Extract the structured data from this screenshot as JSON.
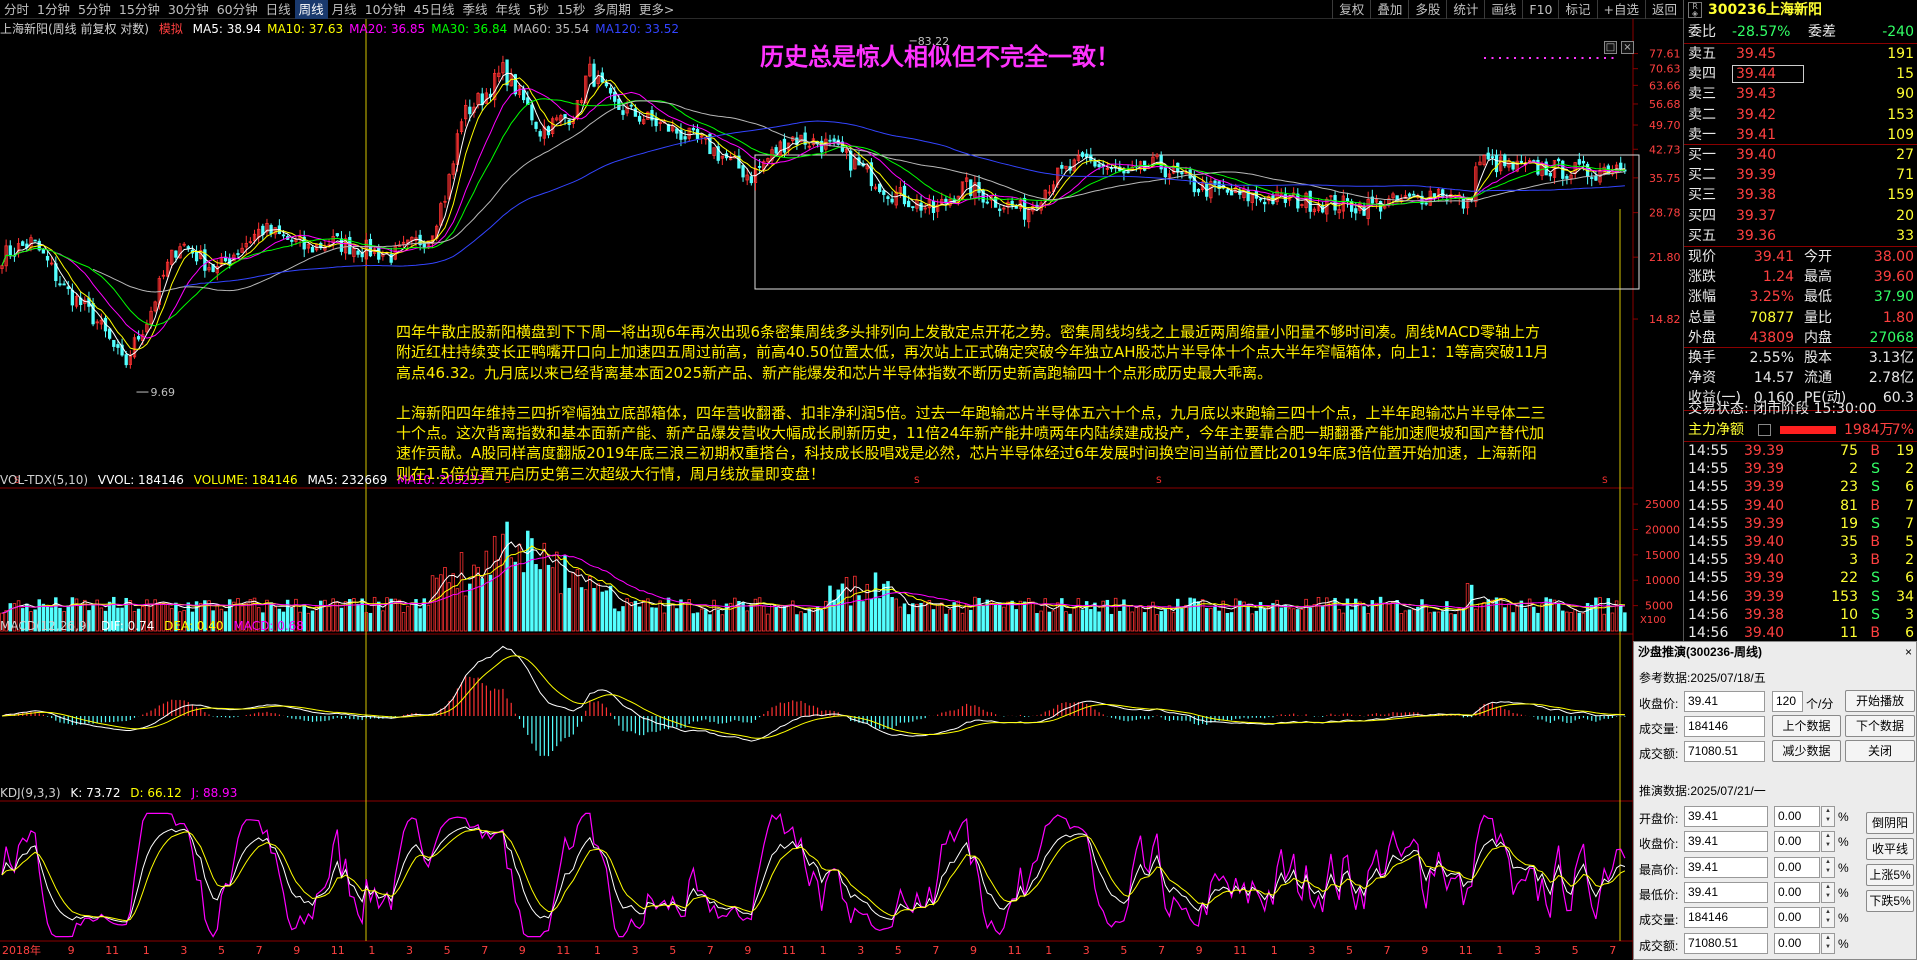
{
  "toolbar": {
    "periods": [
      "分时",
      "1分钟",
      "5分钟",
      "15分钟",
      "30分钟",
      "60分钟",
      "日线",
      "周线",
      "月线",
      "10分钟",
      "45日线",
      "季线",
      "年线",
      "5秒",
      "15秒",
      "多周期",
      "更多>"
    ],
    "active_period": "周线",
    "tools": [
      "复权",
      "叠加",
      "多股",
      "统计",
      "画线",
      "F10",
      "标记",
      "+自选",
      "返回"
    ]
  },
  "main_chart": {
    "stock_name": "上海新阳(周线 前复权 对数)",
    "mode": "模拟",
    "ma": [
      {
        "label": "MA5: 38.94",
        "color": "#ffffff"
      },
      {
        "label": "MA10: 37.63",
        "color": "#ffff00"
      },
      {
        "label": "MA20: 36.85",
        "color": "#ff00ff"
      },
      {
        "label": "MA30: 36.84",
        "color": "#00ff00"
      },
      {
        "label": "MA60: 35.54",
        "color": "#b8b8b8"
      },
      {
        "label": "MA120: 33.52",
        "color": "#3344ff"
      }
    ],
    "title": "历史总是惊人相似但不完全一致！",
    "price_axis": [
      "77.61",
      "70.63",
      "63.66",
      "56.68",
      "49.70",
      "42.73",
      "35.75",
      "28.78",
      "21.80",
      "14.82"
    ],
    "high_label": "83.22",
    "low_label": "9.69"
  },
  "annotation": {
    "p1": "四年牛散庄股新阳横盘到下下周一将出现6年再次出现6条密集周线多头排列向上发散定点开花之势。密集周线均线之上最近两周缩量小阳量不够时间凑。周线MACD零轴上方附近红柱持续变长正鸭嘴开口向上加速四五周过前高，前高40.50位置太低，再次站上正式确定突破今年独立AH股芯片半导体十个点大半年窄幅箱体，向上1：1等高突破11月高点46.32。九月底以来已经背离基本面2025新产品、新产能爆发和芯片半导体指数不断历史新高跑输四十个点形成历史最大乖离。",
    "p2": "上海新阳四年维持三四折窄幅独立底部箱体，四年营收翻番、扣非净利润5倍。过去一年跑输芯片半导体五六十个点，九月底以来跑输三四十个点，上半年跑输芯片半导体二三十个点。这次背离指数和基本面新产能、新产品爆发营收大幅成长刷新历史，11倍24年新产能井喷两年内陆续建成投产，今年主要靠合肥一期翻番产能加速爬坡和国产替代加速作贡献。A股同样高度翻版2019年底三浪三初期权重搭台，科技成长股唱戏是必然，芯片半导体经过6年发展时间换空间当前位置比2019年底3倍位置开始加速，上海新阳则在1.5倍位置开启历史第三次超级大行情，周月线放量即变盘！"
  },
  "vol_panel": {
    "name": "VOL-TDX(5,10)",
    "vvol": "VVOL: 184146",
    "volume": "VOLUME: 184146",
    "ma5": "MA5: 232669",
    "ma10": "MA10: 203233",
    "axis": [
      "25000",
      "20000",
      "15000",
      "10000",
      "5000"
    ],
    "unit": "X100"
  },
  "macd_panel": {
    "name": "MACD(12,26,9)",
    "dif": "DIF: 0.74",
    "dea": "DEA: 0.40",
    "macd": "MACD: 0.68"
  },
  "kdj_panel": {
    "name": "KDJ(9,3,3)",
    "k": "K: 73.72",
    "d": "D: 66.12",
    "j": "J: 88.93"
  },
  "x_axis": [
    "2018年",
    "9",
    "11",
    "1",
    "3",
    "5",
    "7",
    "9",
    "11",
    "1",
    "3",
    "5",
    "7",
    "9",
    "11",
    "1",
    "3",
    "5",
    "7",
    "9",
    "11",
    "1",
    "3",
    "5",
    "7",
    "9",
    "11",
    "1",
    "3",
    "5",
    "7",
    "9",
    "11",
    "1",
    "3",
    "5",
    "7",
    "9",
    "11",
    "1",
    "3",
    "5",
    "7"
  ],
  "quote": {
    "code": "300236",
    "name": "上海新阳",
    "webi_label": "委比",
    "webi": "-28.57%",
    "weicha_label": "委差",
    "weicha": "-240",
    "asks": [
      {
        "label": "卖五",
        "price": "39.45",
        "vol": "191"
      },
      {
        "label": "卖四",
        "price": "39.44",
        "vol": "15"
      },
      {
        "label": "卖三",
        "price": "39.43",
        "vol": "90"
      },
      {
        "label": "卖二",
        "price": "39.42",
        "vol": "153"
      },
      {
        "label": "卖一",
        "price": "39.41",
        "vol": "109"
      }
    ],
    "bids": [
      {
        "label": "买一",
        "price": "39.40",
        "vol": "27"
      },
      {
        "label": "买二",
        "price": "39.39",
        "vol": "71"
      },
      {
        "label": "买三",
        "price": "39.38",
        "vol": "159"
      },
      {
        "label": "买四",
        "price": "39.37",
        "vol": "20"
      },
      {
        "label": "买五",
        "price": "39.36",
        "vol": "33"
      }
    ],
    "stats": [
      {
        "l1": "现价",
        "v1": "39.41",
        "l2": "今开",
        "v2": "38.00"
      },
      {
        "l1": "涨跌",
        "v1": "1.24",
        "l2": "最高",
        "v2": "39.60"
      },
      {
        "l1": "涨幅",
        "v1": "3.25%",
        "l2": "最低",
        "v2": "37.90"
      },
      {
        "l1": "总量",
        "v1": "70877",
        "l2": "量比",
        "v2": "1.80"
      },
      {
        "l1": "外盘",
        "v1": "43809",
        "l2": "内盘",
        "v2": "27068"
      }
    ],
    "stats2": [
      {
        "l1": "换手",
        "v1": "2.55%",
        "l2": "股本",
        "v2": "3.13亿"
      },
      {
        "l1": "净资",
        "v1": "14.57",
        "l2": "流通",
        "v2": "2.78亿"
      },
      {
        "l1": "收益(一)",
        "v1": "0.160",
        "l2": "PE(动)",
        "v2": "60.3"
      }
    ],
    "status": "交易状态: 闭市阶段 15:30:00",
    "flow_label": "主力净额",
    "flow_value": "1984万",
    "flow_pct": "7%",
    "ticks": [
      {
        "t": "14:55",
        "p": "39.39",
        "v": "75",
        "d": "B",
        "n": "19"
      },
      {
        "t": "14:55",
        "p": "39.39",
        "v": "2",
        "d": "S",
        "n": "2"
      },
      {
        "t": "14:55",
        "p": "39.39",
        "v": "23",
        "d": "S",
        "n": "6"
      },
      {
        "t": "14:55",
        "p": "39.40",
        "v": "81",
        "d": "B",
        "n": "7"
      },
      {
        "t": "14:55",
        "p": "39.39",
        "v": "19",
        "d": "S",
        "n": "7"
      },
      {
        "t": "14:55",
        "p": "39.40",
        "v": "35",
        "d": "B",
        "n": "5"
      },
      {
        "t": "14:55",
        "p": "39.40",
        "v": "3",
        "d": "B",
        "n": "2"
      },
      {
        "t": "14:55",
        "p": "39.39",
        "v": "22",
        "d": "S",
        "n": "6"
      },
      {
        "t": "14:56",
        "p": "39.39",
        "v": "153",
        "d": "S",
        "n": "34"
      },
      {
        "t": "14:56",
        "p": "39.38",
        "v": "10",
        "d": "S",
        "n": "3"
      },
      {
        "t": "14:56",
        "p": "39.40",
        "v": "11",
        "d": "B",
        "n": "6"
      }
    ]
  },
  "dialog": {
    "title": "沙盘推演(300236-周线)",
    "close": "×",
    "ref_label": "参考数据:2025/07/18/五",
    "close_label": "收盘价:",
    "close_val": "39.41",
    "vol_label": "成交量:",
    "vol_val": "184146",
    "amt_label": "成交额:",
    "amt_val": "71080.51",
    "speed_val": "120",
    "speed_unit": "个/分",
    "btn_play": "开始播放",
    "btn_prev": "上个数据",
    "btn_next": "下个数据",
    "btn_less": "减少数据",
    "btn_close": "关闭",
    "sim_label": "推演数据:2025/07/21/一",
    "rows": [
      {
        "label": "开盘价:",
        "val": "39.41",
        "pct": "0.00"
      },
      {
        "label": "收盘价:",
        "val": "39.41",
        "pct": "0.00"
      },
      {
        "label": "最高价:",
        "val": "39.41",
        "pct": "0.00"
      },
      {
        "label": "最低价:",
        "val": "39.41",
        "pct": "0.00"
      },
      {
        "label": "成交量:",
        "val": "184146",
        "pct": "0.00"
      },
      {
        "label": "成交额:",
        "val": "71080.51",
        "pct": "0.00"
      }
    ],
    "pct_sign": "%",
    "side_btns": [
      "倒阴阳",
      "收平线",
      "上涨5%",
      "下跌5%"
    ]
  }
}
